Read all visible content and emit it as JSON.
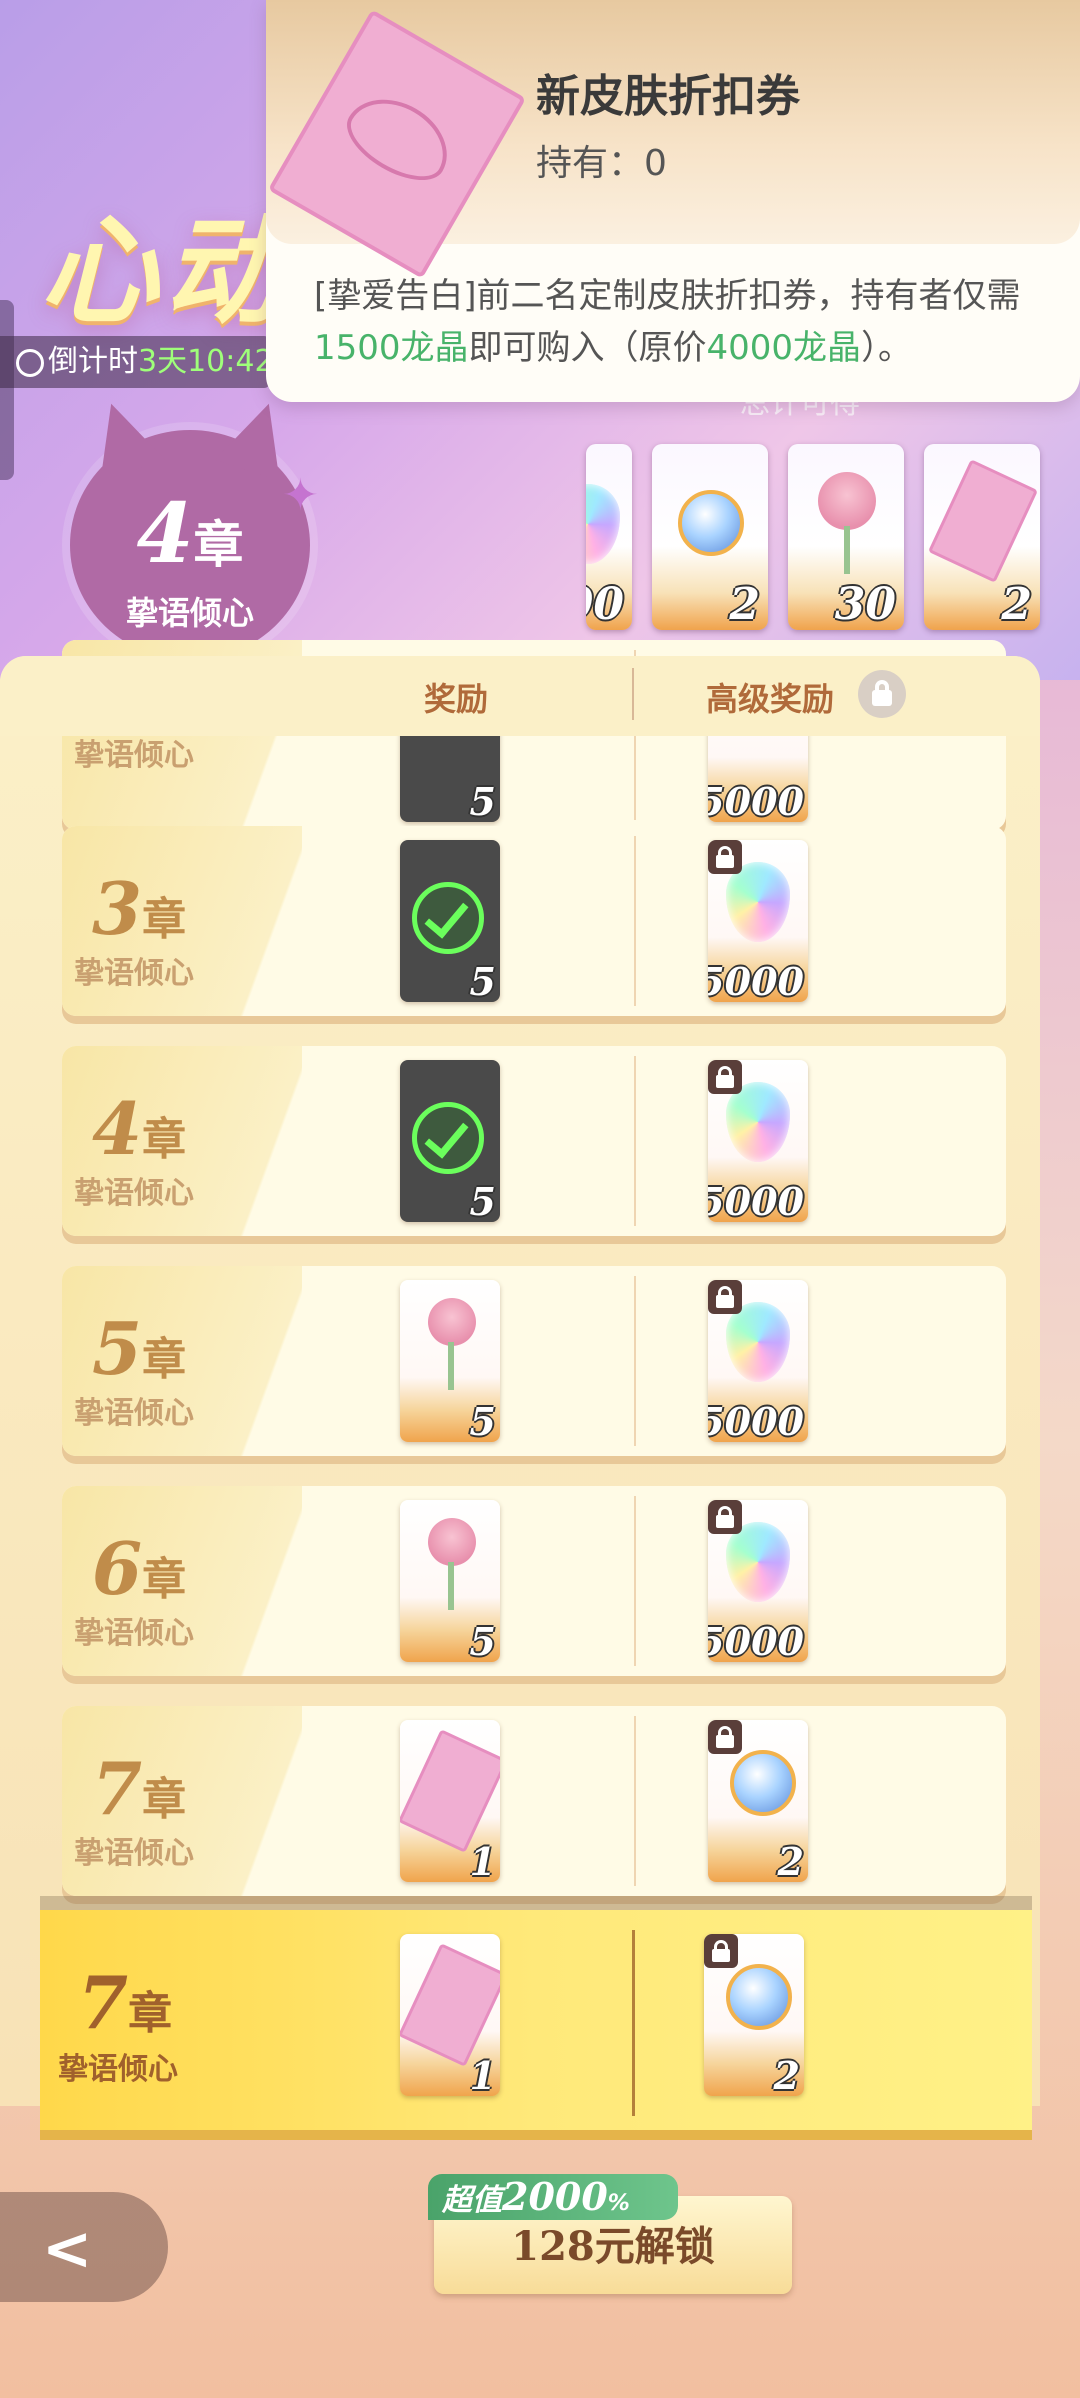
{
  "hero": {
    "title": "心动",
    "countdown_prefix": "倒计时",
    "countdown_time": "3天10:42",
    "faded_text": "总计可得",
    "chapter_num": "4",
    "chapter_unit": "章",
    "chapter_sub": "挚语倾心",
    "rewards": [
      {
        "icon": "gem-icon",
        "qty": "00"
      },
      {
        "icon": "orb-icon",
        "qty": "2"
      },
      {
        "icon": "rose-icon",
        "qty": "30"
      },
      {
        "icon": "ticket-icon",
        "qty": "2"
      }
    ]
  },
  "popup": {
    "title": "新皮肤折扣券",
    "hold_label": "持有：",
    "hold_value": "0",
    "desc_a": "[挚爱告白]前二名定制皮肤折扣券，持有者仅需",
    "desc_b": "1500龙晶",
    "desc_c": "即可购入（原价",
    "desc_d": "4000龙晶",
    "desc_e": "）。"
  },
  "columns": {
    "reward": "奖励",
    "premium": "高级奖励"
  },
  "rows": [
    {
      "num": "",
      "unit": "",
      "sub": "挚语倾心",
      "free_qty": "5",
      "prem_qty": "5000"
    },
    {
      "num": "3",
      "unit": "章",
      "sub": "挚语倾心",
      "free_qty": "5",
      "prem_qty": "5000"
    },
    {
      "num": "4",
      "unit": "章",
      "sub": "挚语倾心",
      "free_qty": "5",
      "prem_qty": "5000"
    },
    {
      "num": "5",
      "unit": "章",
      "sub": "挚语倾心",
      "free_qty": "5",
      "prem_qty": "5000"
    },
    {
      "num": "6",
      "unit": "章",
      "sub": "挚语倾心",
      "free_qty": "5",
      "prem_qty": "5000"
    },
    {
      "num": "7",
      "unit": "章",
      "sub": "挚语倾心",
      "free_qty": "1",
      "prem_qty": "2"
    }
  ],
  "highlight": {
    "num": "7",
    "unit": "章",
    "sub": "挚语倾心",
    "free_qty": "1",
    "prem_qty": "2"
  },
  "bottom": {
    "back_glyph": "<",
    "badge_prefix": "超值",
    "badge_value": "2000",
    "badge_unit": "%",
    "unlock_label": "128元解锁"
  },
  "colors": {
    "accent_green": "#48b36a",
    "gold": "#f0a34c",
    "purple": "#b06aa5"
  }
}
